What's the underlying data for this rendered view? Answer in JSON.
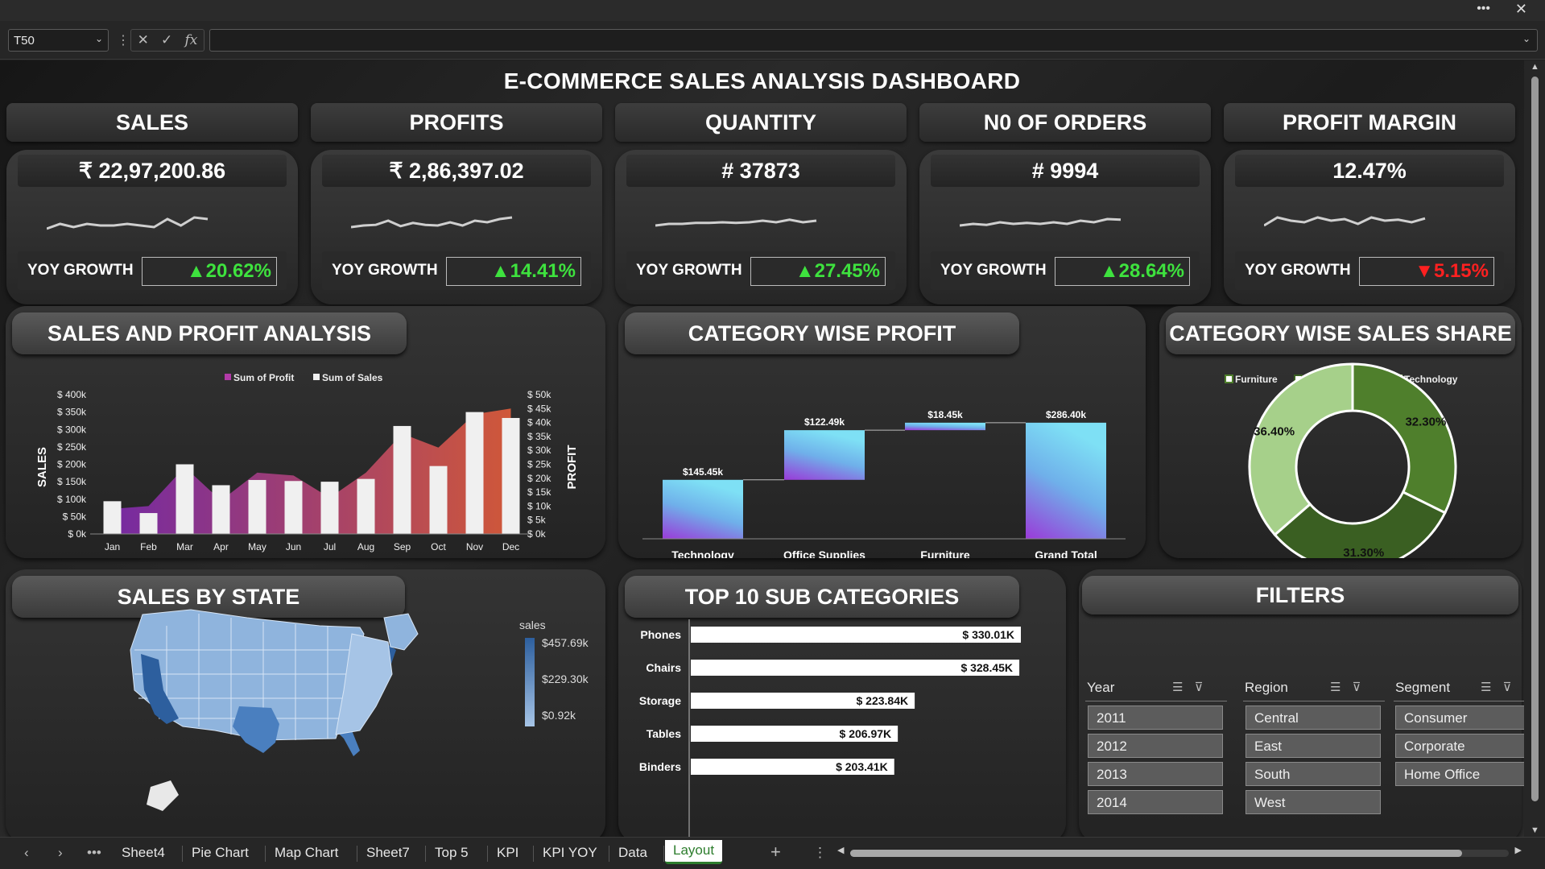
{
  "formula_bar": {
    "name_box": "T50",
    "fx": "fx",
    "formula": ""
  },
  "dashboard": {
    "title": "E-COMMERCE SALES ANALYSIS DASHBOARD"
  },
  "kpis": [
    {
      "header": "SALES",
      "value": "₹ 22,97,200.86",
      "yoy_label": "YOY GROWTH",
      "yoy": "▲20.62%",
      "trend": "up",
      "spark": [
        0.4,
        0.25,
        0.35,
        0.25,
        0.3,
        0.3,
        0.25,
        0.3,
        0.35,
        0.1,
        0.3,
        0.05,
        0.1
      ]
    },
    {
      "header": "PROFITS",
      "value": "₹ 2,86,397.02",
      "yoy_label": "YOY GROWTH",
      "yoy": "▲14.41%",
      "trend": "up",
      "spark": [
        0.35,
        0.3,
        0.28,
        0.15,
        0.32,
        0.22,
        0.28,
        0.3,
        0.2,
        0.3,
        0.15,
        0.2,
        0.1,
        0.05
      ]
    },
    {
      "header": "QUANTITY",
      "value": "# 37873",
      "yoy_label": "YOY GROWTH",
      "yoy": "▲27.45%",
      "trend": "up",
      "spark": [
        0.3,
        0.25,
        0.25,
        0.22,
        0.22,
        0.2,
        0.22,
        0.2,
        0.15,
        0.2,
        0.12,
        0.2,
        0.15
      ]
    },
    {
      "header": "N0 OF ORDERS",
      "value": "# 9994",
      "yoy_label": "YOY GROWTH",
      "yoy": "▲28.64%",
      "trend": "up",
      "spark": [
        0.3,
        0.25,
        0.28,
        0.2,
        0.25,
        0.22,
        0.25,
        0.2,
        0.25,
        0.15,
        0.2,
        0.1,
        0.12
      ]
    },
    {
      "header": "PROFIT MARGIN",
      "value": "12.47%",
      "yoy_label": "YOY GROWTH",
      "yoy": "▼5.15%",
      "trend": "down",
      "spark": [
        0.3,
        0.05,
        0.15,
        0.2,
        0.05,
        0.15,
        0.1,
        0.25,
        0.05,
        0.15,
        0.12,
        0.2,
        0.08
      ]
    }
  ],
  "sales_profit": {
    "title": "SALES AND PROFIT ANALYSIS",
    "y_left_label": "SALES",
    "y_right_label": "PROFIT"
  },
  "category_profit": {
    "title": "CATEGORY WISE PROFIT"
  },
  "category_share": {
    "title": "CATEGORY WISE SALES SHARE"
  },
  "sales_by_state": {
    "title": "SALES BY STATE",
    "legend_title": "sales",
    "legend_max": "$457.69k",
    "legend_mid": "$229.30k",
    "legend_min": "$0.92k"
  },
  "top10": {
    "title": "TOP 10 SUB CATEGORIES"
  },
  "filters": {
    "title": "FILTERS",
    "slicers": [
      {
        "name": "Year",
        "items": [
          "2011",
          "2012",
          "2013",
          "2014"
        ]
      },
      {
        "name": "Region",
        "items": [
          "Central",
          "East",
          "South",
          "West"
        ]
      },
      {
        "name": "Segment",
        "items": [
          "Consumer",
          "Corporate",
          "Home Office"
        ]
      }
    ]
  },
  "sheet_tabs": [
    "Sheet4",
    "Pie Chart",
    "Map Chart",
    "Sheet7",
    "Top 5",
    "KPI",
    "KPI YOY",
    "Data",
    "Layout"
  ],
  "active_tab": "Layout",
  "colors": {
    "accent_green": "#3ee23e",
    "accent_red": "#ff2020",
    "profit_area": "#a23aa8",
    "sales_bar": "#f0f0f0",
    "furniture": "#a6d08a",
    "office_supplies": "#4f7f2c",
    "technology": "#3a5f22"
  },
  "chart_data": [
    {
      "type": "bar",
      "title": "",
      "legend": [
        "Sum of Profit",
        "Sum of Sales"
      ],
      "categories": [
        "Jan",
        "Feb",
        "Mar",
        "Apr",
        "May",
        "Jun",
        "Jul",
        "Aug",
        "Sep",
        "Oct",
        "Nov",
        "Dec"
      ],
      "series": [
        {
          "name": "Sum of Sales",
          "axis": "left",
          "values": [
            94000,
            60000,
            200000,
            140000,
            155000,
            152000,
            150000,
            158000,
            310000,
            195000,
            350000,
            333000
          ]
        },
        {
          "name": "Sum of Profit",
          "axis": "right",
          "values": [
            9000,
            10000,
            24000,
            12000,
            22000,
            21000,
            13000,
            22000,
            36000,
            31000,
            43000,
            45000
          ]
        }
      ],
      "ylim_left": [
        0,
        400000
      ],
      "ylim_right": [
        0,
        50000
      ],
      "yticks_left": [
        "$ 0k",
        "$ 50k",
        "$ 100k",
        "$ 150k",
        "$ 200k",
        "$ 250k",
        "$ 300k",
        "$ 350k",
        "$ 400k"
      ],
      "yticks_right": [
        "$ 0k",
        "$ 5k",
        "$ 10k",
        "$ 15k",
        "$ 20k",
        "$ 25k",
        "$ 30k",
        "$ 35k",
        "$ 40k",
        "$ 45k",
        "$ 50k"
      ],
      "xlabel": "",
      "ylabel": "SALES",
      "ylabel_right": "PROFIT",
      "legend_position": "top-center"
    },
    {
      "type": "bar",
      "subtype": "waterfall",
      "title": "",
      "categories": [
        "Technology",
        "Office Supplies",
        "Furniture",
        "Grand Total"
      ],
      "values": [
        145.45,
        122.49,
        18.45,
        286.4
      ],
      "labels": [
        "$145.45k",
        "$122.49k",
        "$18.45k",
        "$286.40k"
      ],
      "ylim": [
        0,
        300
      ]
    },
    {
      "type": "pie",
      "subtype": "donut",
      "title": "",
      "categories": [
        "Furniture",
        "Office Supplies",
        "Technology"
      ],
      "values": [
        32.3,
        31.3,
        36.4
      ],
      "labels": [
        "32.30%",
        "31.30%",
        "36.40%"
      ],
      "colors": [
        "#4f7f2c",
        "#3a5f22",
        "#a6d08a"
      ],
      "legend_position": "top"
    },
    {
      "type": "bar",
      "orientation": "horizontal",
      "title": "",
      "categories": [
        "Phones",
        "Chairs",
        "Storage",
        "Tables",
        "Binders"
      ],
      "values": [
        330.01,
        328.45,
        223.84,
        206.97,
        203.41
      ],
      "labels": [
        "$ 330.01K",
        "$ 328.45K",
        "$ 223.84K",
        "$ 206.97K",
        "$ 203.41K"
      ]
    }
  ]
}
